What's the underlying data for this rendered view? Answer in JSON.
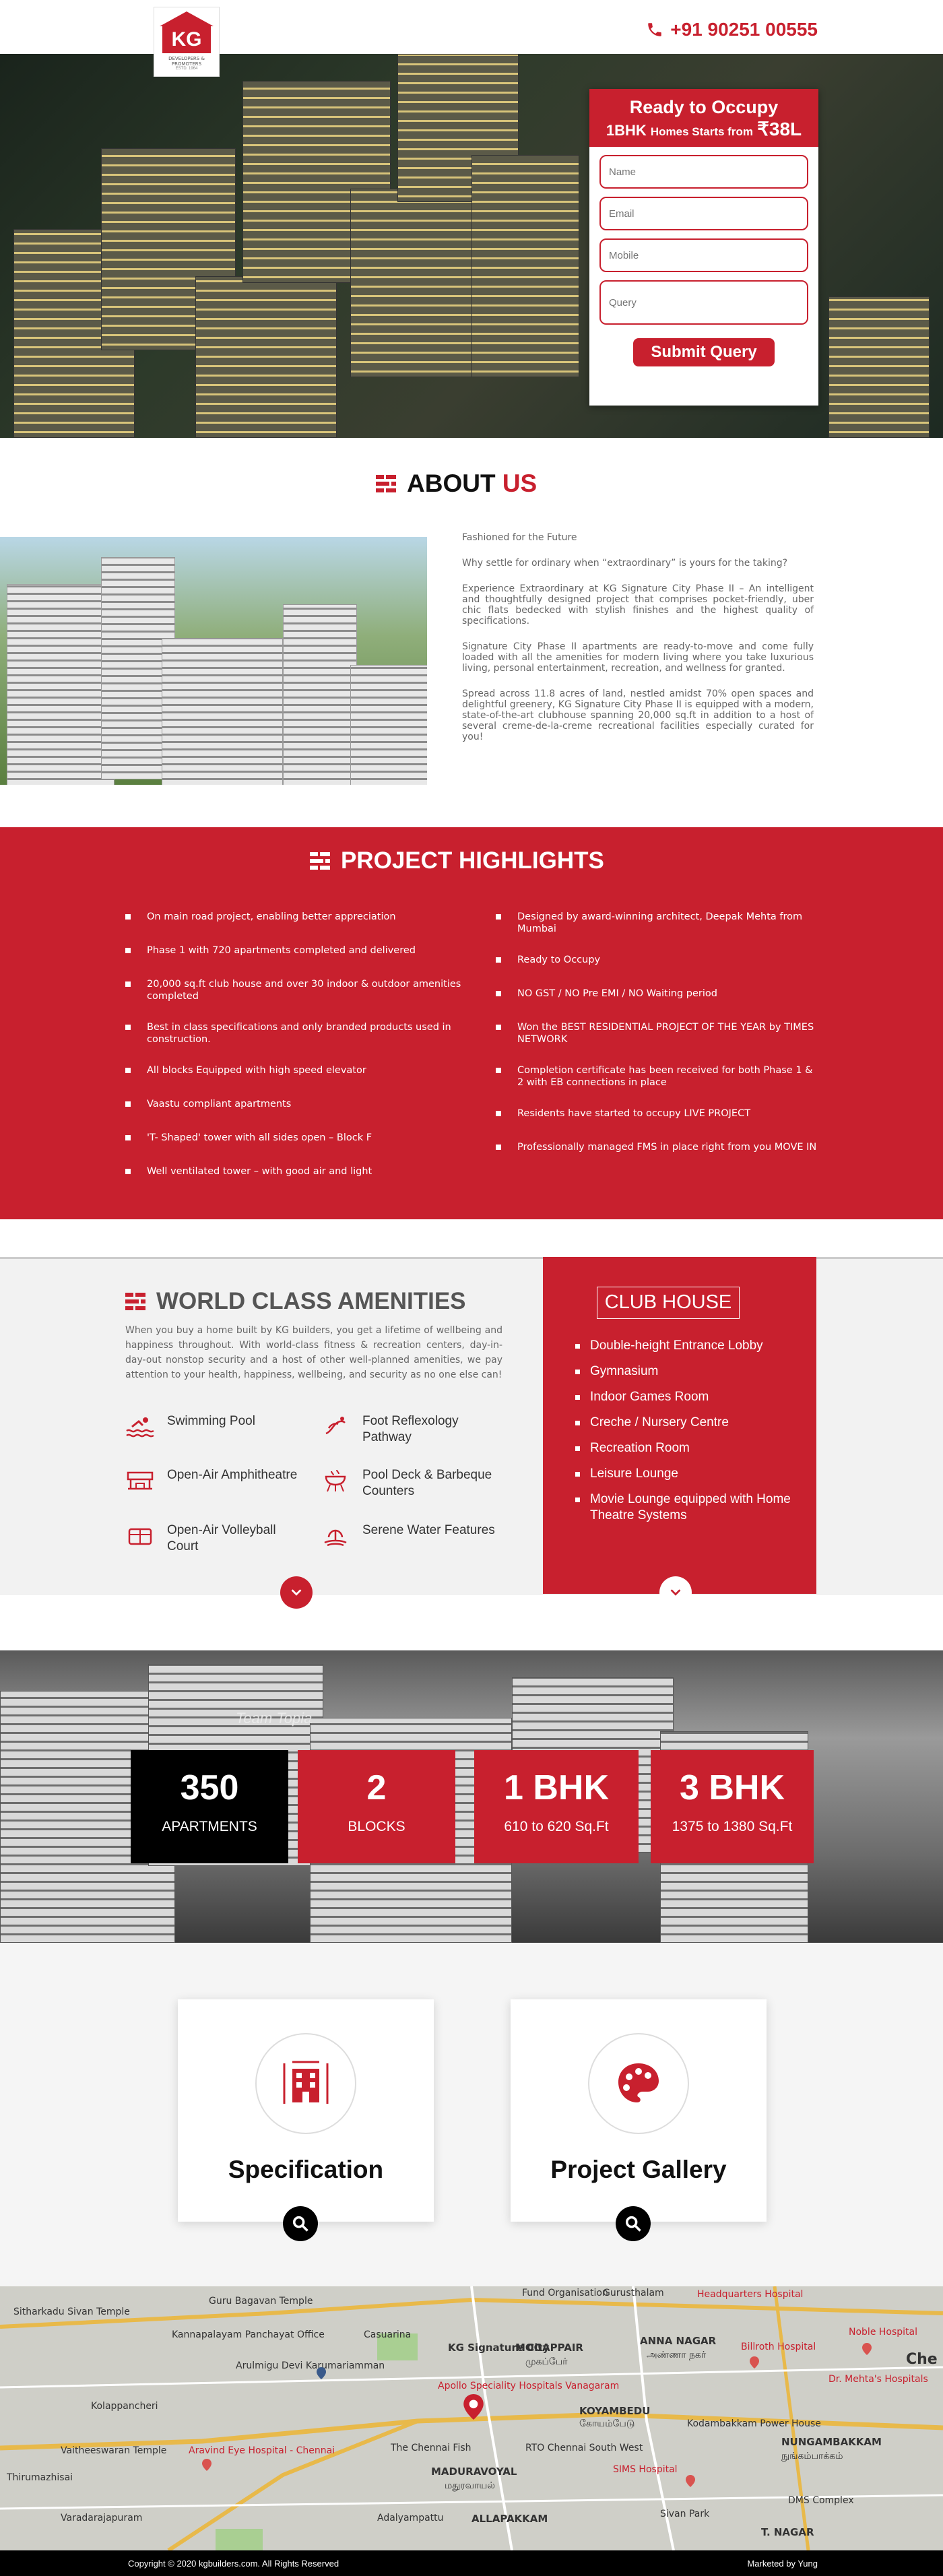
{
  "header": {
    "logo_text": "KG",
    "logo_tagline": "DEVELOPERS & PROMOTERS",
    "logo_since": "ESTD. 1964",
    "phone": "+91 90251 00555"
  },
  "hero": {
    "form": {
      "headline": "Ready to Occupy",
      "sub_prefix": "1BHK",
      "sub_middle": "Homes Starts from",
      "sub_price": "₹38L",
      "name_placeholder": "Name",
      "email_placeholder": "Email",
      "mobile_placeholder": "Mobile",
      "query_placeholder": "Query",
      "submit_label": "Submit Query"
    }
  },
  "about": {
    "title_a": "ABOUT",
    "title_b": "US",
    "paragraphs": [
      "Fashioned for the Future",
      "Why settle for ordinary when “extraordinary” is yours for the taking?",
      "Experience Extraordinary at KG Signature City Phase II – An intelligent and thoughtfully designed project that comprises pocket-friendly, uber chic flats bedecked with stylish finishes and the highest quality of specifications.",
      "Signature City Phase II apartments are ready-to-move and come fully loaded with all the amenities for modern living where you take luxurious living, personal entertainment, recreation, and wellness for granted.",
      "Spread across 11.8 acres of land, nestled amidst 70% open spaces and delightful greenery, KG Signature City Phase II is equipped with a modern, state-of-the-art clubhouse spanning 20,000 sq.ft in addition to a host of several creme-de-la-creme recreational facilities especially curated for you!"
    ]
  },
  "highlights": {
    "title": "PROJECT HIGHLIGHTS",
    "left": [
      "On main road project, enabling better appreciation",
      "Phase 1 with 720 apartments completed and delivered",
      "20,000 sq.ft club house and over 30 indoor & outdoor amenities completed",
      "Best in class specifications and only branded products used in construction.",
      "All blocks Equipped with high speed elevator",
      "Vaastu compliant apartments",
      "'T- Shaped' tower with all sides open – Block F",
      "Well ventilated tower – with good air and light"
    ],
    "right": [
      "Designed by award-winning architect, Deepak Mehta from Mumbai",
      "Ready to Occupy",
      "NO GST / NO Pre EMI / NO Waiting period",
      "Won the BEST RESIDENTIAL PROJECT OF THE YEAR by TIMES NETWORK",
      "Completion certificate has been received for both Phase 1 & 2 with EB connections in place",
      "Residents have started to occupy LIVE PROJECT",
      "Professionally managed FMS in place right from you MOVE IN"
    ]
  },
  "amenities": {
    "title": "WORLD CLASS AMENITIES",
    "description": "When you buy a home built by KG builders, you get a lifetime of wellbeing and happiness throughout. With world-class fitness & recreation centers, day-in-day-out nonstop security and a host of other well-planned amenities, we pay attention to your health, happiness, wellbeing, and security as no one else can!",
    "items": [
      {
        "label": "Swimming Pool",
        "icon": "swimming-icon"
      },
      {
        "label": "Foot Reflexology Pathway",
        "icon": "footprint-icon"
      },
      {
        "label": "Open-Air Amphitheatre",
        "icon": "amphitheatre-icon"
      },
      {
        "label": "Pool Deck & Barbeque Counters",
        "icon": "barbeque-icon"
      },
      {
        "label": "Open-Air Volleyball Court",
        "icon": "volleyball-icon"
      },
      {
        "label": "Serene Water Features",
        "icon": "fountain-icon"
      }
    ],
    "club_title": "CLUB HOUSE",
    "club_items": [
      "Double-height Entrance Lobby",
      "Gymnasium",
      "Indoor Games Room",
      "Creche / Nursery Centre",
      "Recreation Room",
      "Leisure Lounge",
      "Movie Lounge equipped with Home Theatre Systems"
    ]
  },
  "stats": {
    "watermark": "Team  Topia",
    "items": [
      {
        "number": "350",
        "label": "APARTMENTS",
        "color": "#000000"
      },
      {
        "number": "2",
        "label": "BLOCKS",
        "color": "#c8202e"
      },
      {
        "number": "1 BHK",
        "label": "610 to 620 Sq.Ft",
        "color": "#c8202e"
      },
      {
        "number": "3 BHK",
        "label": "1375 to 1380 Sq.Ft",
        "color": "#c8202e"
      }
    ]
  },
  "cards": [
    {
      "title": "Specification",
      "icon": "building-spec-icon"
    },
    {
      "title": "Project Gallery",
      "icon": "palette-icon"
    }
  ],
  "map": {
    "labels": [
      "Fund Organisation",
      "Gurusthalam",
      "Headquarters Hospital",
      "Guru Bagavan Temple",
      "Sitharkadu Sivan Temple",
      "Kannapalayam Panchayat Office",
      "Casuarina",
      "KG Signature City",
      "MOGAPPAIR",
      "முகப்பேர்",
      "ANNA NAGAR",
      "அண்ணா நகர்",
      "Billroth Hospital",
      "Noble Hospital",
      "Arulmigu Devi Karumariamman",
      "Kolappancheri",
      "Apollo Speciality Hospitals Vanagaram",
      "KOYAMBEDU",
      "கோயம்பேடு",
      "Dr. Mehta's Hospitals",
      "Kodambakkam Power House",
      "NUNGAMBAKKAM",
      "நுங்கம்பாக்கம்",
      "Vaitheeswaran Temple",
      "Aravind Eye Hospital - Chennai",
      "The Chennai Fish",
      "MADURAVOYAL",
      "மதுரவாயல்",
      "RTO Chennai South West",
      "SIMS Hospital",
      "Thirumazhisai",
      "Varadarajapuram",
      "Adalyampattu",
      "ALLAPAKKAM",
      "Sivan Park",
      "DMS Complex",
      "T. NAGAR",
      "Che"
    ]
  },
  "footer": {
    "copyright": "Copyright © 2020 kgbuilders.com. All Rights Reserved",
    "marketed": "Marketed by Yung"
  }
}
